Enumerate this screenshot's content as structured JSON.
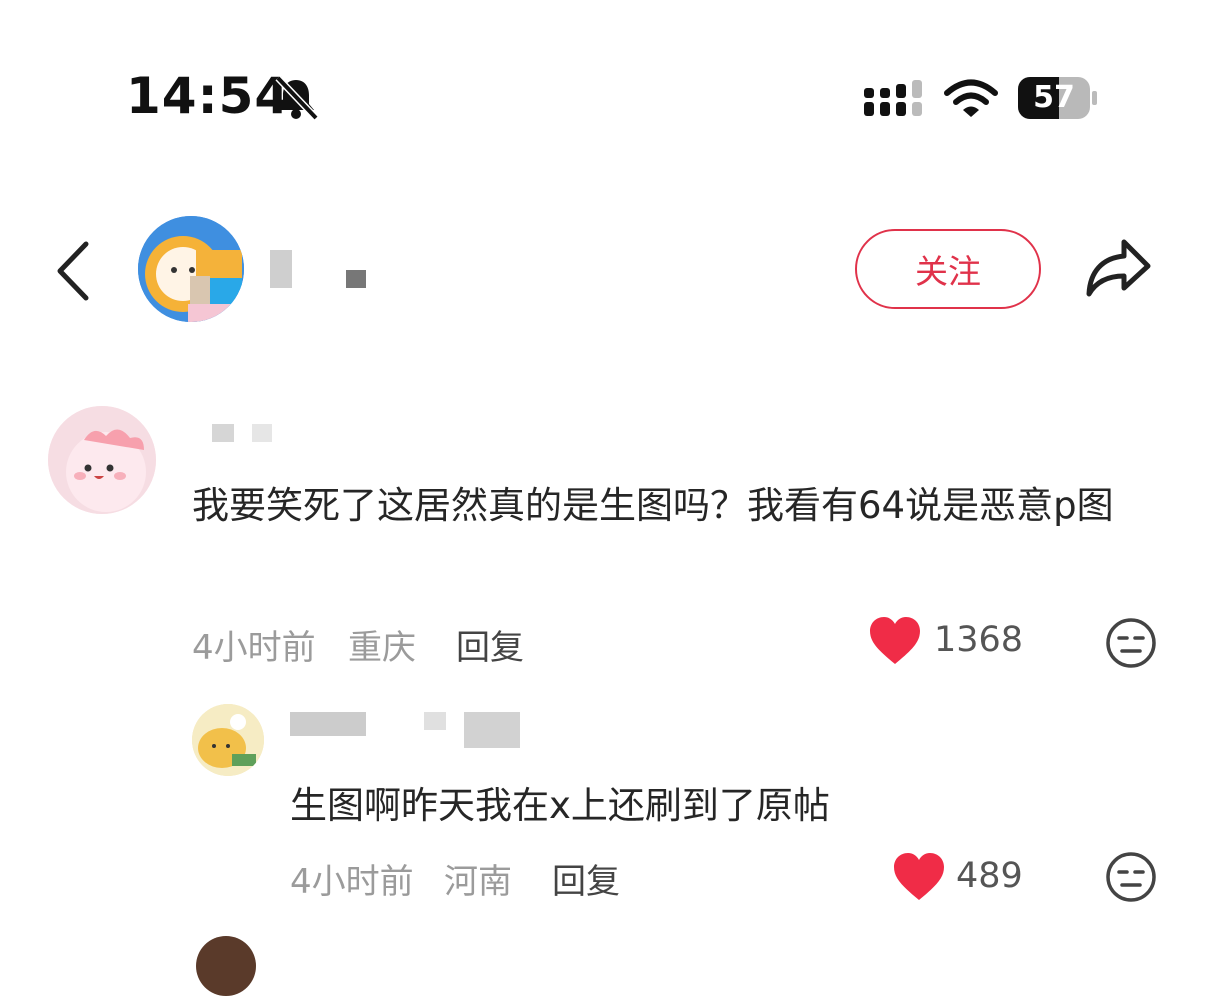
{
  "status_bar": {
    "time": "14:54",
    "battery": "57"
  },
  "header": {
    "follow_label": "关注"
  },
  "comments": [
    {
      "text": "我要笑死了这居然真的是生图吗？我看有64说是恶意p图",
      "time": "4小时前",
      "location": "重庆",
      "reply_label": "回复",
      "likes": "1368"
    },
    {
      "text": "生图啊昨天我在x上还刷到了原帖",
      "time": "4小时前",
      "location": "河南",
      "reply_label": "回复",
      "likes": "489"
    }
  ],
  "colors": {
    "accent": "#e0324a",
    "like_heart": "#f02c47"
  }
}
